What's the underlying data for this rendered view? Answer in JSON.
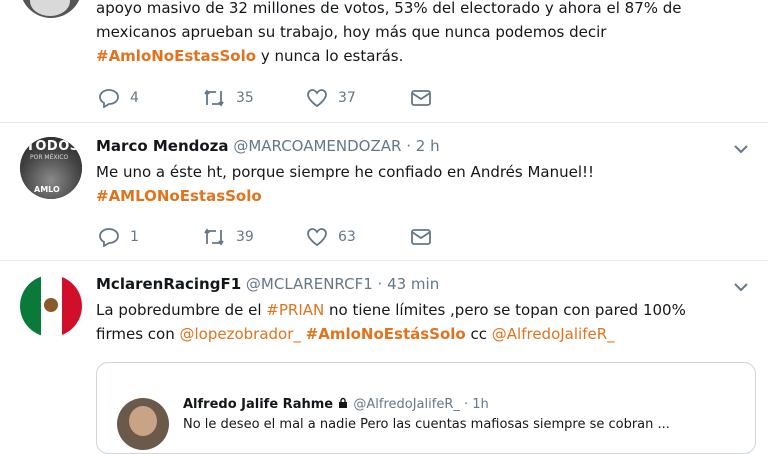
{
  "tweet1": {
    "lines": [
      "apoyo masivo de 32 millones de votos, 53% del electorado y ahora el 87% de",
      "mexicanos aprueban su trabajo, hoy más que nunca podemos decir"
    ],
    "hashtag": "#AmloNoEstasSolo",
    "tail": " y nunca lo estarás.",
    "replies": "4",
    "retweets": "35",
    "likes": "37"
  },
  "tweet2": {
    "name": "Marco Mendoza",
    "handle": "@MARCOAMENDOZAR",
    "sep": " · ",
    "time": "2 h",
    "text": "Me uno a éste ht, porque siempre he confiado en Andrés Manuel!!",
    "hashtag": "#AMLONoEstasSolo",
    "replies": "1",
    "retweets": "39",
    "likes": "63",
    "avatar_text": "TODOS",
    "avatar_sub": "POR MÉXICO",
    "avatar_bottom": "AMLO"
  },
  "tweet3": {
    "name": "MclarenRacingF1",
    "handle": "@MCLARENRCF1",
    "sep": " · ",
    "time": "43 min",
    "line1_a": "La pobredumbre de el ",
    "line1_tag": "#PRIAN",
    "line1_b": " no tiene límites ,pero se topan con pared 100%",
    "line2_a": "firmes con ",
    "line2_mention1": "@lopezobrador_",
    "line2_tag": "#AmloNoEstásSolo",
    "line2_cc": " cc ",
    "line2_mention2": "@AlfredoJalifeR_"
  },
  "quote": {
    "name": "Alfredo Jalife Rahme",
    "handle": "@AlfredoJalifeR_",
    "sep": " · ",
    "time": "1h",
    "text": "No le deseo el mal a nadie Pero las cuentas mafiosas siempre se cobran ..."
  },
  "colors": {
    "accent": "#e0731e",
    "muted": "#657786",
    "border": "#e6ecf0"
  }
}
